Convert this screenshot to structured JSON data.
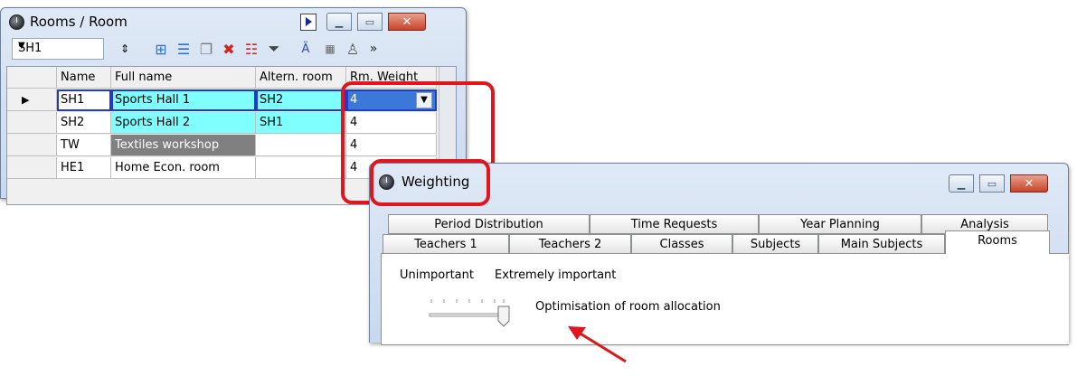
{
  "rooms_window": {
    "title": "Rooms / Room",
    "combo_value": "SH1",
    "columns": [
      "Name",
      "Full name",
      "Altern. room",
      "Rm. Weight"
    ],
    "rows": [
      {
        "indicator": "▶",
        "name": "SH1",
        "full_name": "Sports Hall 1",
        "altern": "SH2",
        "weight": "4"
      },
      {
        "indicator": "",
        "name": "SH2",
        "full_name": "Sports Hall 2",
        "altern": "SH1",
        "weight": "4"
      },
      {
        "indicator": "",
        "name": "TW",
        "full_name": "Textiles workshop",
        "altern": "",
        "weight": "4"
      },
      {
        "indicator": "",
        "name": "HE1",
        "full_name": "Home Econ. room",
        "altern": "",
        "weight": "4"
      }
    ]
  },
  "weighting_window": {
    "title": "Weighting",
    "tabs_row1": [
      "Period Distribution",
      "Time Requests",
      "Year Planning",
      "Analysis"
    ],
    "tabs_row2": [
      "Teachers 1",
      "Teachers 2",
      "Classes",
      "Subjects",
      "Main Subjects",
      "Rooms"
    ],
    "active_tab": "Rooms",
    "label_low": "Unimportant",
    "label_high": "Extremely important",
    "slider_label": "Optimisation of room allocation",
    "slider_value_fraction": 1.0
  },
  "colors": {
    "highlight_red": "#e0151d",
    "cyan_cell": "#80ffff",
    "gray_cell": "#808080"
  }
}
